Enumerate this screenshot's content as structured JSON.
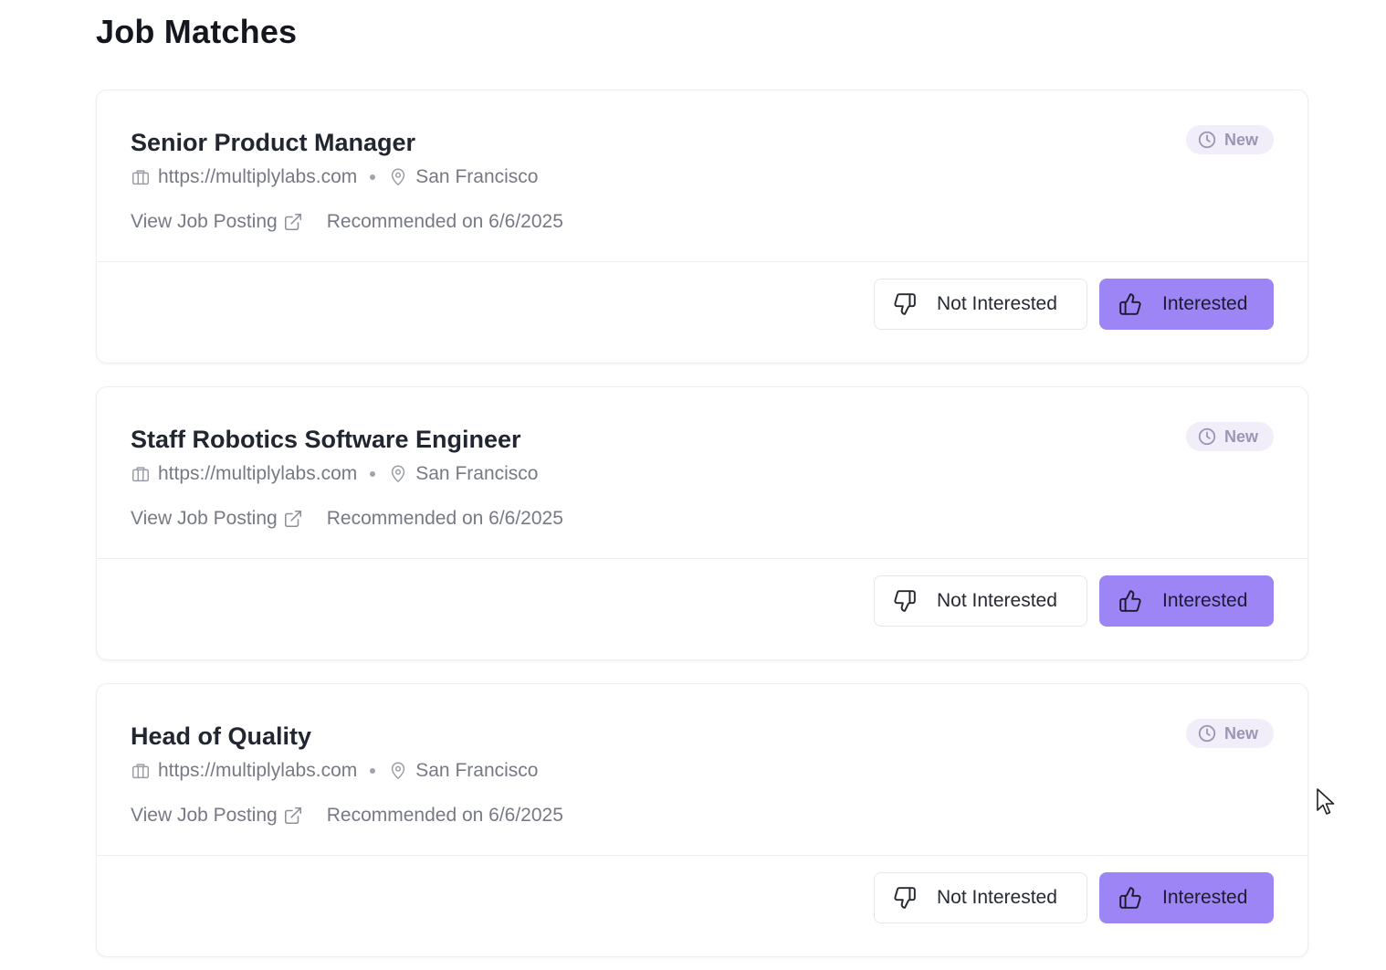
{
  "page": {
    "title": "Job Matches"
  },
  "colors": {
    "primary_button": "#9d85f5",
    "badge_background": "#f1eef9",
    "badge_text": "#9c96b4",
    "muted_text": "#777a84"
  },
  "icons": {
    "company": "building-icon",
    "location": "map-pin-icon",
    "external": "external-link-icon",
    "badge": "clock-icon",
    "not_interested": "thumbs-down-icon",
    "interested": "thumbs-up-icon",
    "cursor": "mouse-cursor-icon"
  },
  "jobs": [
    {
      "title": "Senior Product Manager",
      "company_url": "https://multiplylabs.com",
      "location": "San Francisco",
      "view_link_label": "View Job Posting",
      "recommended": "Recommended on 6/6/2025",
      "status": "New",
      "not_interested_label": "Not Interested",
      "interested_label": "Interested"
    },
    {
      "title": "Staff Robotics Software Engineer",
      "company_url": "https://multiplylabs.com",
      "location": "San Francisco",
      "view_link_label": "View Job Posting",
      "recommended": "Recommended on 6/6/2025",
      "status": "New",
      "not_interested_label": "Not Interested",
      "interested_label": "Interested"
    },
    {
      "title": "Head of Quality",
      "company_url": "https://multiplylabs.com",
      "location": "San Francisco",
      "view_link_label": "View Job Posting",
      "recommended": "Recommended on 6/6/2025",
      "status": "New",
      "not_interested_label": "Not Interested",
      "interested_label": "Interested"
    }
  ]
}
